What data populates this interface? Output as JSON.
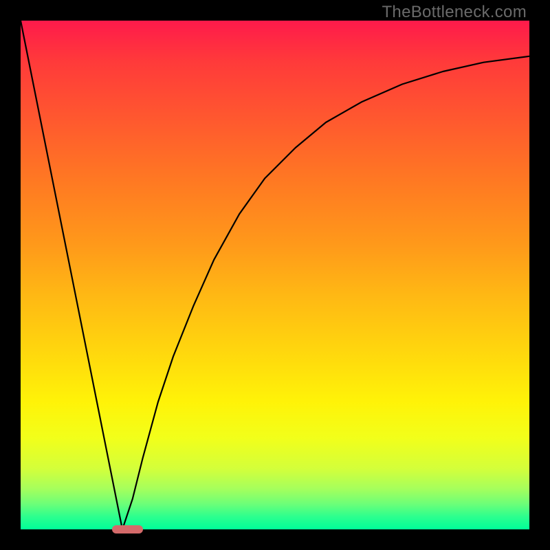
{
  "watermark": "TheBottleneck.com",
  "chart_data": {
    "type": "line",
    "title": "",
    "xlabel": "",
    "ylabel": "",
    "xlim": [
      0,
      100
    ],
    "ylim": [
      0,
      100
    ],
    "curve_points": [
      {
        "x": 0.0,
        "y": 100.0
      },
      {
        "x": 3.0,
        "y": 85.0
      },
      {
        "x": 6.0,
        "y": 70.0
      },
      {
        "x": 9.0,
        "y": 55.0
      },
      {
        "x": 12.0,
        "y": 40.0
      },
      {
        "x": 15.0,
        "y": 25.0
      },
      {
        "x": 18.0,
        "y": 10.0
      },
      {
        "x": 20.0,
        "y": 0.0
      },
      {
        "x": 22.0,
        "y": 6.0
      },
      {
        "x": 24.0,
        "y": 14.0
      },
      {
        "x": 27.0,
        "y": 25.0
      },
      {
        "x": 30.0,
        "y": 34.0
      },
      {
        "x": 34.0,
        "y": 44.0
      },
      {
        "x": 38.0,
        "y": 53.0
      },
      {
        "x": 43.0,
        "y": 62.0
      },
      {
        "x": 48.0,
        "y": 69.0
      },
      {
        "x": 54.0,
        "y": 75.0
      },
      {
        "x": 60.0,
        "y": 80.0
      },
      {
        "x": 67.0,
        "y": 84.0
      },
      {
        "x": 75.0,
        "y": 87.5
      },
      {
        "x": 83.0,
        "y": 90.0
      },
      {
        "x": 91.0,
        "y": 91.8
      },
      {
        "x": 100.0,
        "y": 93.0
      }
    ],
    "marker": {
      "x_start": 18.0,
      "x_end": 24.0,
      "color": "#d46a6a"
    },
    "gradient_stops": [
      {
        "offset": 0.0,
        "color": "#ff1a4b"
      },
      {
        "offset": 0.5,
        "color": "#ffd40e"
      },
      {
        "offset": 0.82,
        "color": "#f2ff1a"
      },
      {
        "offset": 1.0,
        "color": "#00ff99"
      }
    ]
  }
}
